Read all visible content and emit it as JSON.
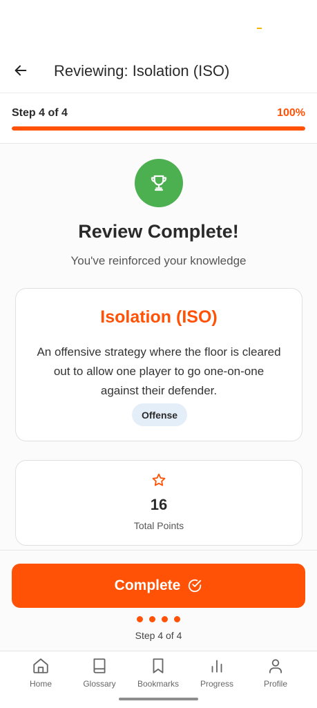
{
  "header": {
    "title": "Reviewing: Isolation (ISO)",
    "back_icon": "arrow-left-icon"
  },
  "progress": {
    "step_text": "Step 4 of 4",
    "percent_text": "100%",
    "fraction": 1.0,
    "color": "#ff5206"
  },
  "result": {
    "icon": "trophy-icon",
    "icon_bg": "#4caf50",
    "headline": "Review Complete!",
    "subline": "You've reinforced your knowledge"
  },
  "term": {
    "title": "Isolation (ISO)",
    "description": "An offensive strategy where the floor is cleared out to allow one player to go one-on-one against their defender.",
    "tag": "Offense"
  },
  "points": {
    "icon": "star-icon",
    "value": "16",
    "label": "Total Points"
  },
  "footer": {
    "button_label": "Complete",
    "button_icon": "check-circle-icon",
    "dots_count": 4,
    "step_text": "Step 4 of 4"
  },
  "nav": {
    "items": [
      {
        "label": "Home",
        "icon": "home-icon"
      },
      {
        "label": "Glossary",
        "icon": "book-icon"
      },
      {
        "label": "Bookmarks",
        "icon": "bookmark-icon"
      },
      {
        "label": "Progress",
        "icon": "bar-chart-icon"
      },
      {
        "label": "Profile",
        "icon": "profile-icon"
      }
    ]
  },
  "colors": {
    "accent": "#ff5206",
    "success": "#4caf50",
    "tag_bg": "#e3eef9"
  }
}
